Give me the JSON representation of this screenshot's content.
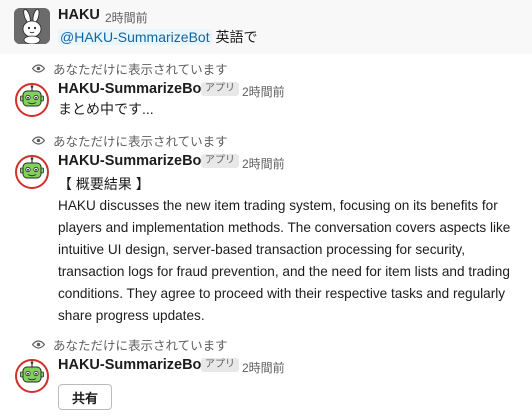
{
  "message_1": {
    "sender": "HAKU",
    "time": "2時間前",
    "mention": "@HAKU-SummarizeBot",
    "text_after_mention": " 英語で"
  },
  "ephemeral_label": "あなただけに表示されています",
  "message_2": {
    "sender": "HAKU-SummarizeBot",
    "badge": "アプリ",
    "time": "2時間前",
    "text": "まとめ中です..."
  },
  "message_3": {
    "sender": "HAKU-SummarizeBot",
    "badge": "アプリ",
    "time": "2時間前",
    "heading": "【 概要結果 】",
    "body": "HAKU discusses the new item trading system, focusing on its benefits for players and implementation methods. The conversation covers aspects like intuitive UI design, server-based transaction processing for security, transaction logs for fraud prevention, and the need for item lists and trading conditions. They agree to proceed with their respective tasks and regularly share progress updates."
  },
  "message_4": {
    "sender": "HAKU-SummarizeBot",
    "badge": "アプリ",
    "time": "2時間前",
    "share_label": "共有"
  },
  "avatar_bot_label": "HAKU",
  "colors": {
    "mention_text": "#1264a3",
    "mention_bg": "#e8f5fa",
    "bot_avatar_green": "#7fd35a",
    "bot_avatar_red": "#d0302a"
  },
  "icons": {
    "ephemeral": "eye-icon",
    "user_avatar": "rabbit-avatar",
    "bot_avatar": "robot-avatar"
  }
}
